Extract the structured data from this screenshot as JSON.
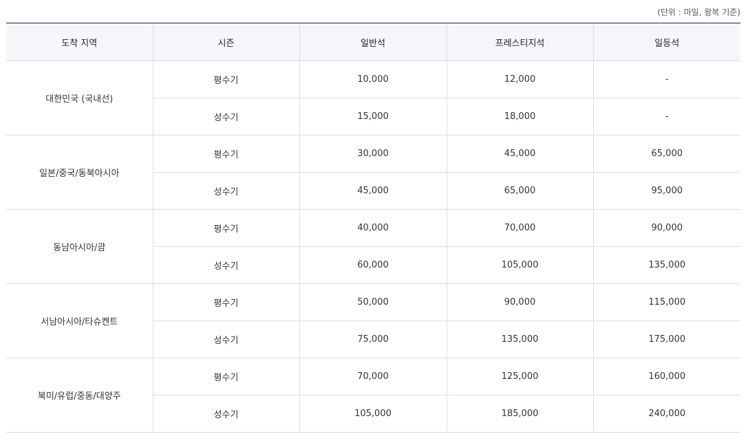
{
  "unit_note": "(단위 : 마일, 왕복 기준)",
  "columns": [
    "도착 지역",
    "시즌",
    "일반석",
    "프레스티지석",
    "일등석"
  ],
  "regions": [
    {
      "name": "대한민국 (국내선)",
      "rows": [
        {
          "season": "평수기",
          "economy": "10,000",
          "prestige": "12,000",
          "first": "-"
        },
        {
          "season": "성수기",
          "economy": "15,000",
          "prestige": "18,000",
          "first": "-"
        }
      ]
    },
    {
      "name": "일본/중국/동북아시아",
      "rows": [
        {
          "season": "평수기",
          "economy": "30,000",
          "prestige": "45,000",
          "first": "65,000"
        },
        {
          "season": "성수기",
          "economy": "45,000",
          "prestige": "65,000",
          "first": "95,000"
        }
      ]
    },
    {
      "name": "동남아시아/괌",
      "rows": [
        {
          "season": "평수기",
          "economy": "40,000",
          "prestige": "70,000",
          "first": "90,000"
        },
        {
          "season": "성수기",
          "economy": "60,000",
          "prestige": "105,000",
          "first": "135,000"
        }
      ]
    },
    {
      "name": "서남아시아/타슈켄트",
      "rows": [
        {
          "season": "평수기",
          "economy": "50,000",
          "prestige": "90,000",
          "first": "115,000"
        },
        {
          "season": "성수기",
          "economy": "75,000",
          "prestige": "135,000",
          "first": "175,000"
        }
      ]
    },
    {
      "name": "북미/유럽/중동/대양주",
      "rows": [
        {
          "season": "평수기",
          "economy": "70,000",
          "prestige": "125,000",
          "first": "160,000"
        },
        {
          "season": "성수기",
          "economy": "105,000",
          "prestige": "185,000",
          "first": "240,000"
        }
      ]
    }
  ]
}
